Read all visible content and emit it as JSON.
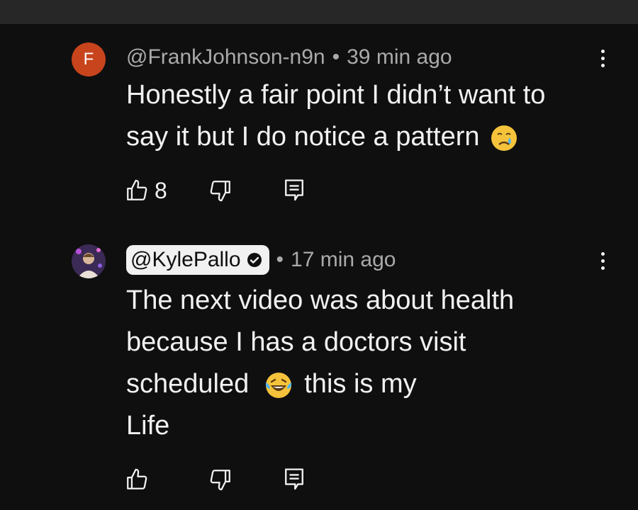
{
  "comments": [
    {
      "avatar_letter": "F",
      "author": "@FrankJohnson-n9n",
      "separator": "•",
      "time": "39 min ago",
      "lines": [
        "Honestly a fair point I didn’t want to",
        "say it but I do notice a pattern"
      ],
      "emoji": "crying-face",
      "likes": "8"
    },
    {
      "author": "@KylePallo",
      "separator": "•",
      "time": "17 min ago",
      "lines": [
        "The next video was about health",
        "because I has a doctors visit",
        "scheduled",
        "Life"
      ],
      "inline_text": "this is my",
      "emoji": "laughing-tears-face",
      "likes": ""
    }
  ],
  "colors": {
    "background": "#0f0f0f",
    "top_bar": "#272727",
    "avatar_f": "#c7441d",
    "secondary_text": "#aaaaaa",
    "primary_text": "#f1f1f1"
  }
}
